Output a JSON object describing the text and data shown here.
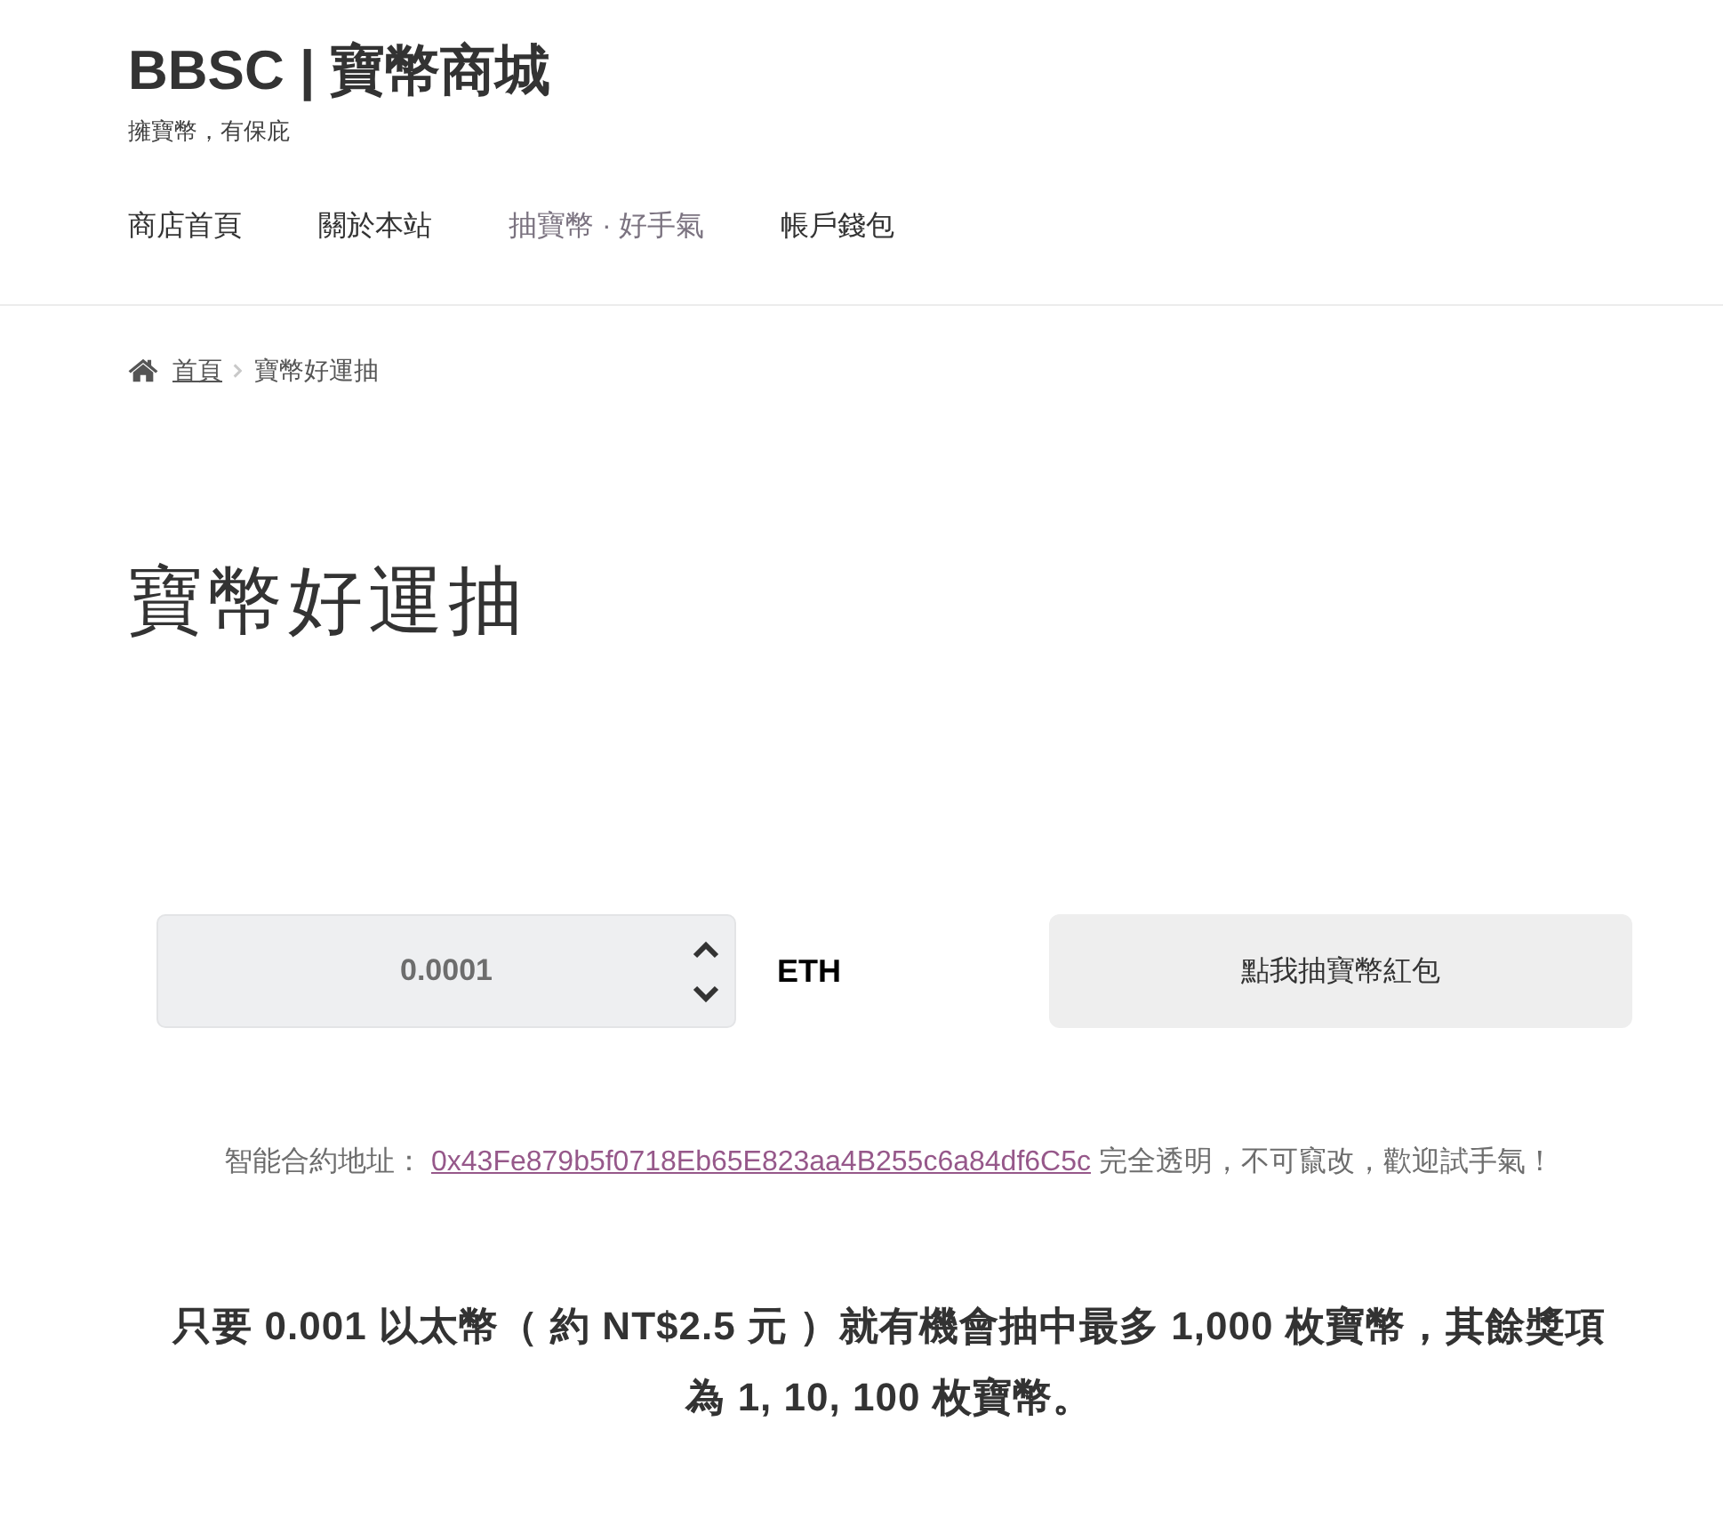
{
  "site": {
    "title": "BBSC | 寶幣商城",
    "tagline": "擁寶幣，有保庇"
  },
  "nav": [
    {
      "label": "商店首頁",
      "selected": false
    },
    {
      "label": "關於本站",
      "selected": false
    },
    {
      "label": "抽寶幣 · 好手氣",
      "selected": true
    },
    {
      "label": "帳戶錢包",
      "selected": false
    }
  ],
  "breadcrumb": {
    "home": "首頁",
    "current": "寶幣好運抽"
  },
  "page_title": "寶幣好運抽",
  "amount": {
    "value": "0.0001",
    "unit": "ETH"
  },
  "draw_button": "點我抽寶幣紅包",
  "contract": {
    "label": "智能合約地址：",
    "address": "0x43Fe879b5f0718Eb65E823aa4B255c6a84df6C5c",
    "note": "完全透明，不可竄改，歡迎試手氣！"
  },
  "notice": "只要 0.001 以太幣（ 約 NT$2.5 元 ）就有機會抽中最多 1,000 枚寶幣，其餘獎項為 1, 10, 100 枚寶幣。"
}
